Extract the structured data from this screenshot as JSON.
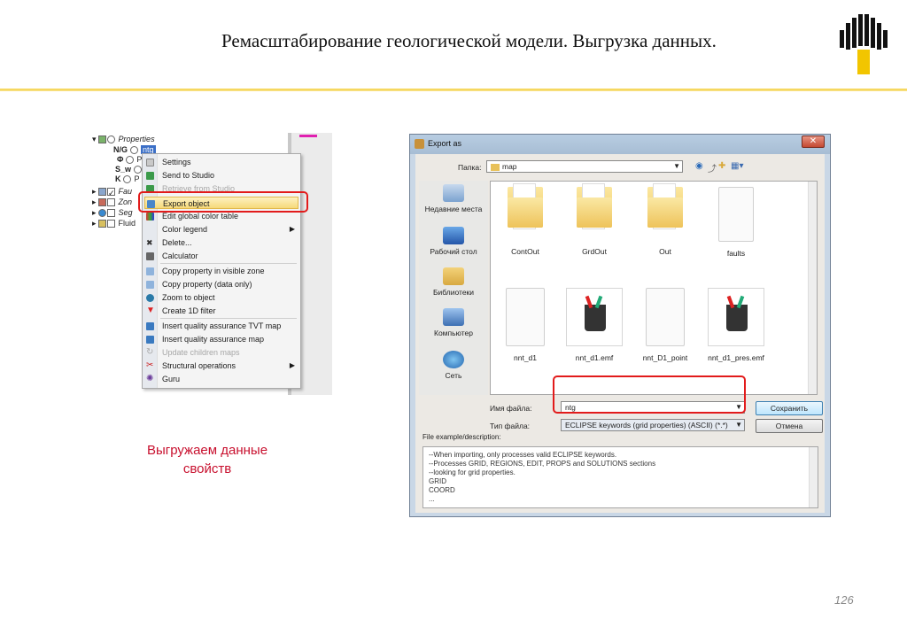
{
  "slide": {
    "title": "Ремасштабирование геологической модели. Выгрузка данных.",
    "caption_line1": "Выгружаем данные",
    "caption_line2": "свойств",
    "page_number": "126",
    "accent_color": "#c8102e",
    "rule_color": "#f4d24a"
  },
  "tree": {
    "rows": [
      "Properties",
      "ntg",
      "P",
      "S",
      "P",
      "Fau",
      "Zon",
      "Seg",
      "Fluid"
    ],
    "prefix_glyphs": [
      "N/G",
      "Φ",
      "S_w",
      "K"
    ]
  },
  "context_menu": {
    "items": [
      {
        "label": "Settings"
      },
      {
        "label": "Send to Studio"
      },
      {
        "label": "Retrieve from Studio"
      },
      {
        "label": "Export object"
      },
      {
        "label": "Edit global color table"
      },
      {
        "label": "Color legend"
      },
      {
        "label": "Delete..."
      },
      {
        "label": "Calculator"
      },
      {
        "label": "Copy property in visible zone"
      },
      {
        "label": "Copy property (data only)"
      },
      {
        "label": "Zoom to object"
      },
      {
        "label": "Create 1D filter"
      },
      {
        "label": "Insert quality assurance TVT map"
      },
      {
        "label": "Insert quality assurance map"
      },
      {
        "label": "Update children maps"
      },
      {
        "label": "Structural operations"
      },
      {
        "label": "Guru"
      }
    ]
  },
  "dialog": {
    "title": "Export as",
    "close_glyph": "✕",
    "folder_label": "Папка:",
    "folder_value": "map",
    "places": [
      "Недавние места",
      "Рабочий стол",
      "Библиотеки",
      "Компьютер",
      "Сеть"
    ],
    "files": [
      "ContOut",
      "GrdOut",
      "Out",
      "faults",
      "nnt_d1",
      "nnt_d1.emf",
      "nnt_D1_point",
      "nnt_d1_pres.emf"
    ],
    "filename_label": "Имя файла:",
    "filename_value": "ntg",
    "filetype_label": "Тип файла:",
    "filetype_value": "ECLIPSE keywords (grid properties) (ASCII) (*.*)",
    "save_button": "Сохранить",
    "cancel_button": "Отмена",
    "desc_label": "File example/description:",
    "desc_lines": [
      "--When importing, only processes valid ECLIPSE keywords.",
      "--Processes GRID, REGIONS, EDIT, PROPS and SOLUTIONS  sections",
      "--looking for grid properties.",
      "GRID",
      "COORD",
      "..."
    ]
  }
}
